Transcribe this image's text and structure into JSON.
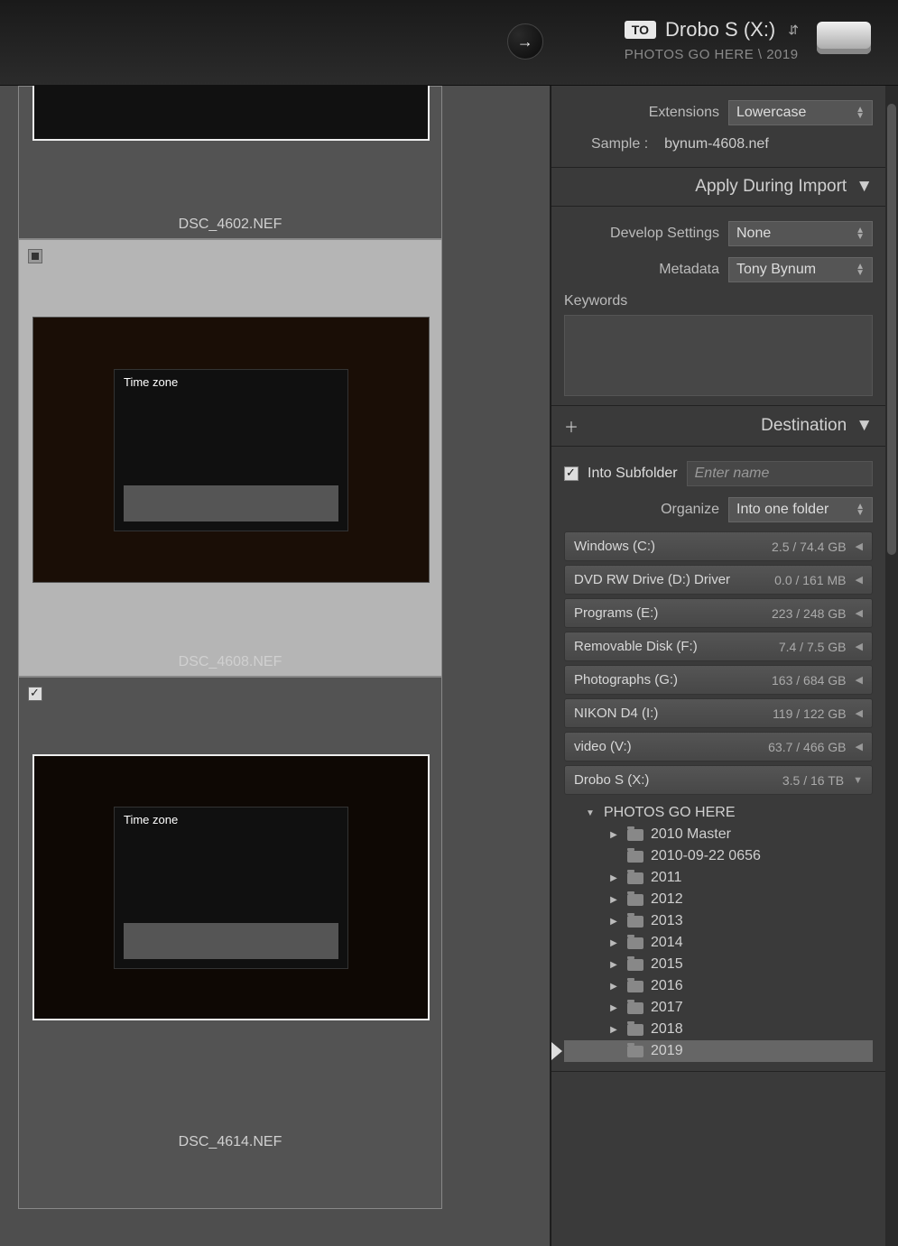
{
  "topbar": {
    "to_label": "TO",
    "drive": "Drobo S (X:)",
    "path": "PHOTOS GO HERE \\ 2019"
  },
  "thumbnails": {
    "t1_label": "DSC_4602.NEF",
    "t2_label": "DSC_4608.NEF",
    "t3_label": "DSC_4614.NEF",
    "lcd_title": "Time zone"
  },
  "file_naming": {
    "extensions_label": "Extensions",
    "extensions_value": "Lowercase",
    "sample_label": "Sample :",
    "sample_value": "bynum-4608.nef"
  },
  "apply": {
    "title": "Apply During Import",
    "develop_label": "Develop Settings",
    "develop_value": "None",
    "metadata_label": "Metadata",
    "metadata_value": "Tony Bynum",
    "keywords_label": "Keywords"
  },
  "destination": {
    "title": "Destination",
    "subfolder_label": "Into Subfolder",
    "subfolder_placeholder": "Enter name",
    "organize_label": "Organize",
    "organize_value": "Into one folder"
  },
  "volumes": [
    {
      "name": "Windows (C:)",
      "size": "2.5 / 74.4 GB",
      "open": false
    },
    {
      "name": "DVD RW Drive (D:) Driver",
      "size": "0.0 / 161 MB",
      "open": false
    },
    {
      "name": "Programs (E:)",
      "size": "223 / 248 GB",
      "open": false
    },
    {
      "name": "Removable Disk (F:)",
      "size": "7.4 / 7.5 GB",
      "open": false
    },
    {
      "name": "Photographs (G:)",
      "size": "163 / 684 GB",
      "open": false
    },
    {
      "name": "NIKON D4 (I:)",
      "size": "119 / 122 GB",
      "open": false
    },
    {
      "name": "video (V:)",
      "size": "63.7 / 466 GB",
      "open": false
    },
    {
      "name": "Drobo S (X:)",
      "size": "3.5 / 16 TB",
      "open": true
    }
  ],
  "tree": {
    "root": "PHOTOS GO HERE",
    "children": [
      {
        "name": "2010 Master",
        "expandable": true
      },
      {
        "name": "2010-09-22 0656",
        "expandable": false
      },
      {
        "name": "2011",
        "expandable": true
      },
      {
        "name": "2012",
        "expandable": true
      },
      {
        "name": "2013",
        "expandable": true
      },
      {
        "name": "2014",
        "expandable": true
      },
      {
        "name": "2015",
        "expandable": true
      },
      {
        "name": "2016",
        "expandable": true
      },
      {
        "name": "2017",
        "expandable": true
      },
      {
        "name": "2018",
        "expandable": true
      },
      {
        "name": "2019",
        "expandable": false,
        "current": true
      }
    ]
  }
}
